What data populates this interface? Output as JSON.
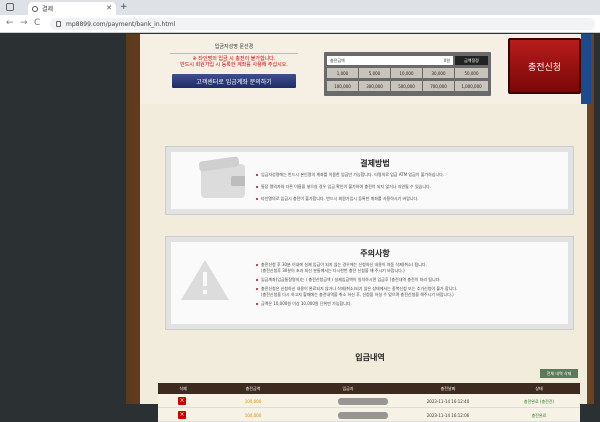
{
  "browser": {
    "tab_title": "결제",
    "url": "mp8899.com/payment/bank_in.html",
    "new_tab": "+",
    "close": "✕",
    "back": "←",
    "forward": "→",
    "reload": "C"
  },
  "notice": {
    "heading": "입금자성명 문선경",
    "lines": [
      "※ 타인명의 입금 시 충전이 불가합니다.",
      "반드시 회원가입 시 등록한 계좌를 사용해 주십시오."
    ],
    "cs_button": "고객센터로 입금계좌 문의하기"
  },
  "amount_panel": {
    "label": "충전금액",
    "unit": "0원",
    "reset": "금액정정",
    "buttons": [
      "1,000",
      "5,000",
      "10,000",
      "30,000",
      "50,000",
      "100,000",
      "300,000",
      "500,000",
      "700,000",
      "1,000,000"
    ]
  },
  "charge_button": "충전신청",
  "section1": {
    "title": "결제방법",
    "bullets": [
      "입금자성명에는 반드시 본인명의 계좌를 이용한 입금만 가능합니다. 타명의로 입금 ATM 입금이 불가하십니다.",
      "통장 명의자와 다른 이름을 넣으실 경우 입금 확인이 불가하여 충전이 되지 않거나 지연될 수 있습니다.",
      "타인명의로 입금시 충전이 불가합니다. 반드시 회원가입시 등록한 계좌를 사용하시기 바랍니다."
    ]
  },
  "section2": {
    "title": "주의사항",
    "bullets": [
      "충전신청 후 30분 이내에 실제 입금이 되지 않는 경우에는 신청하신 내용이 자동 삭제(취소) 됩니다.",
      "입금계좌(입금통장명의)는 / 충전신청금액 / 실제입금액이 일치하시면 입금후 [충전내역 충전이 처리 됩니다.",
      "충전신청은 신청하신 내용이 완료되지 않거나 삭제(취소)되기 않은 상태에서는 중복신청 또는 추가신청이 불가 합니다.",
      "금액은 10,000원 이상 10,000원 단위만 가능합니다."
    ],
    "sublines": [
      "(충전신청후 30분이 초과 되신 분들께서는 다시한번 충전 신청을 해 주시기 바랍니다.)",
      "(충전신청을 다시 하고자 할때에는 충전내역을 취소 하신 후, 신청을 하실 수 있으며 충전신청을 해주시기 바랍니다.)"
    ]
  },
  "history": {
    "title": "입금내역",
    "delete_all": "전체 내역 삭제",
    "columns": [
      "삭제",
      "충전금액",
      "입금자",
      "충전날짜",
      "상태"
    ],
    "rows": [
      {
        "amount": "100,000",
        "date": "2023-11-14 16:12:40",
        "status": "충전완료 (충전전)"
      },
      {
        "amount": "100,000",
        "date": "2023-11-14 16:12:06",
        "status": "충전완료"
      }
    ]
  }
}
